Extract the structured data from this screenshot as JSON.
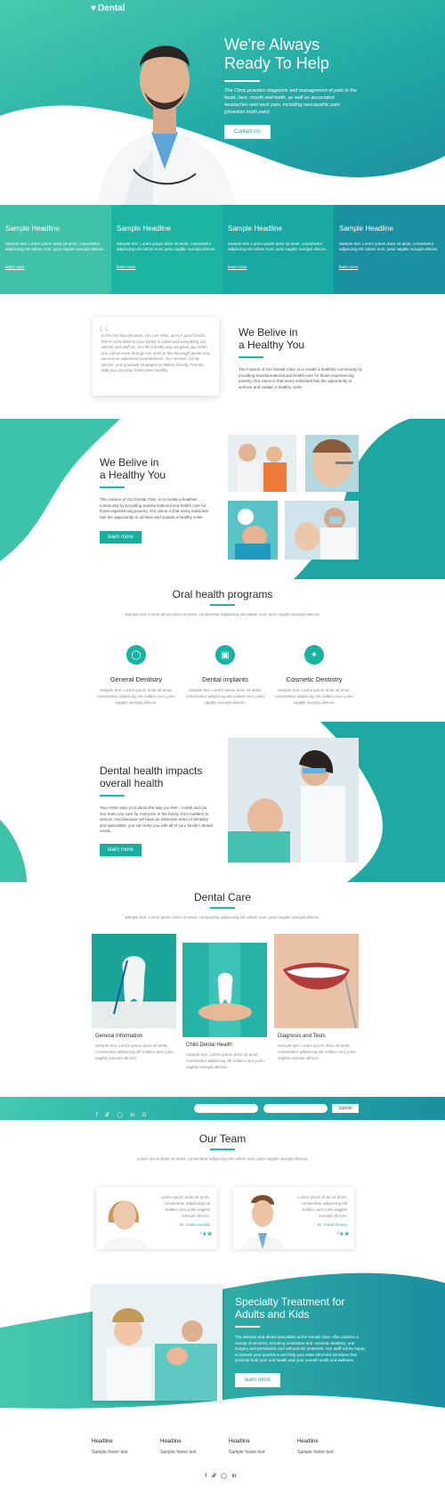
{
  "brand": {
    "name": "Dental"
  },
  "hero": {
    "title_line1": "We're Always",
    "title_line2": "Ready To Help",
    "text": "The Clinic provides diagnosis and management of pain in the head, face, mouth and teeth, as well as associated headaches and neck pain, including neuropathic pain (phantom tooth pain).",
    "button": "Contact Us"
  },
  "features": [
    {
      "title": "Sample Headline",
      "text": "Sample text. Lorem ipsum dolor sit amet, consectetur adipiscing elit nullam nunc justo sagittis suscipit ultrices.",
      "link": "learn more"
    },
    {
      "title": "Sample Headline",
      "text": "Sample text. Lorem ipsum dolor sit amet, consectetur adipiscing elit nullam nunc justo sagittis suscipit ultrices.",
      "link": "learn more"
    },
    {
      "title": "Sample Headline",
      "text": "Sample text. Lorem ipsum dolor sit amet, consectetur adipiscing elit nullam nunc justo sagittis suscipit ultrices.",
      "link": "learn more"
    },
    {
      "title": "Sample Headline",
      "text": "Sample text. Lorem ipsum dolor sit amet, consectetur adipiscing elit nullam nunc justo sagittis suscipit ultrices.",
      "link": "learn more"
    }
  ],
  "quote": {
    "text": "In the last few decades, you can relax, up to it good hands. We're committed to your family is cared well everything our dentist and staff do. For the friendly way we greet you when you call us even through our drive to the thorough gentle way we ensure advanced examinations. Our mission, family dentist, and graduate strategies to deliver friendly Friends help you and your loved ones healthy.",
    "title_line1": "We Belive in",
    "title_line2": "a Healthy You",
    "body": "The mission of Our Dental Clinic is to create a healthier community by providing transformational and health care for those experiencing poverty. Our vision is that every individual has the opportunity to achieve and sustain a healthy smile."
  },
  "belive2": {
    "title_line1": "We Belive in",
    "title_line2": "a Healthy You",
    "body": "The mission of Our Dental Clinic is to create a healthier community by providing transformational and health care for those experiencing poverty. Our vision is that every individual has the opportunity to achieve and sustain a healthy smile.",
    "button": "learn more"
  },
  "programs": {
    "title": "Oral health programs",
    "subtitle": "Sample text. Lorem ipsum dolor sit amet, consectetur adipiscing elit nullam nunc justo sagittis suscipit ultrices.",
    "items": [
      {
        "title": "General Dentistry",
        "text": "Sample text. Lorem ipsum dolor sit amet, consectetur adipiscing elit nullam nunc justo sagittis suscipit ultrices."
      },
      {
        "title": "Dental implants",
        "text": "Sample text. Lorem ipsum dolor sit amet, consectetur adipiscing elit nullam nunc justo sagittis suscipit ultrices."
      },
      {
        "title": "Cosmetic Dentistry",
        "text": "Sample text. Lorem ipsum dolor sit amet, consectetur adipiscing elit nullam nunc justo sagittis suscipit ultrices."
      }
    ]
  },
  "impacts": {
    "title_line1": "Dental health impacts",
    "title_line2": "overall health",
    "body": "Your smile says a lot about the way you feel – inside and out. Our team can care for everyone in the family, from toddlers to seniors. And because we have an extensive team of dentistry and specialists, you can keep you with all of your family's dental needs.",
    "button": "learn more"
  },
  "care": {
    "title": "Dental Care",
    "subtitle": "Sample text. Lorem ipsum dolor sit amet, consectetur adipiscing elit nullam nunc justo sagittis suscipit ultrices.",
    "items": [
      {
        "title": "General Information",
        "text": "Sample text. Lorem ipsum dolor sit amet, consectetur adipiscing elit nullam nunc justo sagittis suscipit ultrices."
      },
      {
        "title": "Child Dental Health",
        "text": "Sample text. Lorem ipsum dolor sit amet, consectetur adipiscing elit nullam nunc justo sagittis suscipit ultrices."
      },
      {
        "title": "Diagnosis and Tests",
        "text": "Sample text. Lorem ipsum dolor sit amet, consectetur adipiscing elit nullam nunc justo sagittis suscipit ultrices."
      }
    ]
  },
  "newsletter": {
    "button": "Submit"
  },
  "team": {
    "title": "Our Team",
    "subtitle": "Lorem ipsum dolor sit amet, consectetur adipiscing elit nullam nunc justo sagittis suscipit ultrices.",
    "members": [
      {
        "text": "Lorem ipsum dolor sit amet, consectetur adipiscing elit nullam nunc justo sagittis suscipit ultrices.",
        "name": "Dr. Carla Kinrelle"
      },
      {
        "text": "Lorem ipsum dolor sit amet, consectetur adipiscing elit nullam nunc justo sagittis suscipit ultrices.",
        "name": "Dr. Frank Finney"
      }
    ]
  },
  "specialty": {
    "title_line1": "Specialty Treatment for",
    "title_line2": "Adults and Kids",
    "body": "The dentists and dental specialists at the Dental Clinic offer patients a variety of services, including restorative and cosmetic dentistry, oral surgery and periodontic and orthodontic treatment. Our staff will be happy to answer your questions and help you make informed decisions that promote both your oral health and your overall health and wellness.",
    "button": "learn more"
  },
  "footer": {
    "cols": [
      {
        "head": "Headline",
        "text": "Sample footer text"
      },
      {
        "head": "Headline",
        "text": "Sample footer text"
      },
      {
        "head": "Headline",
        "text": "Sample footer text"
      },
      {
        "head": "Headline",
        "text": "Sample footer text"
      }
    ]
  },
  "colors": {
    "accent": "#1fb5a7",
    "dark_teal": "#178f9c"
  }
}
